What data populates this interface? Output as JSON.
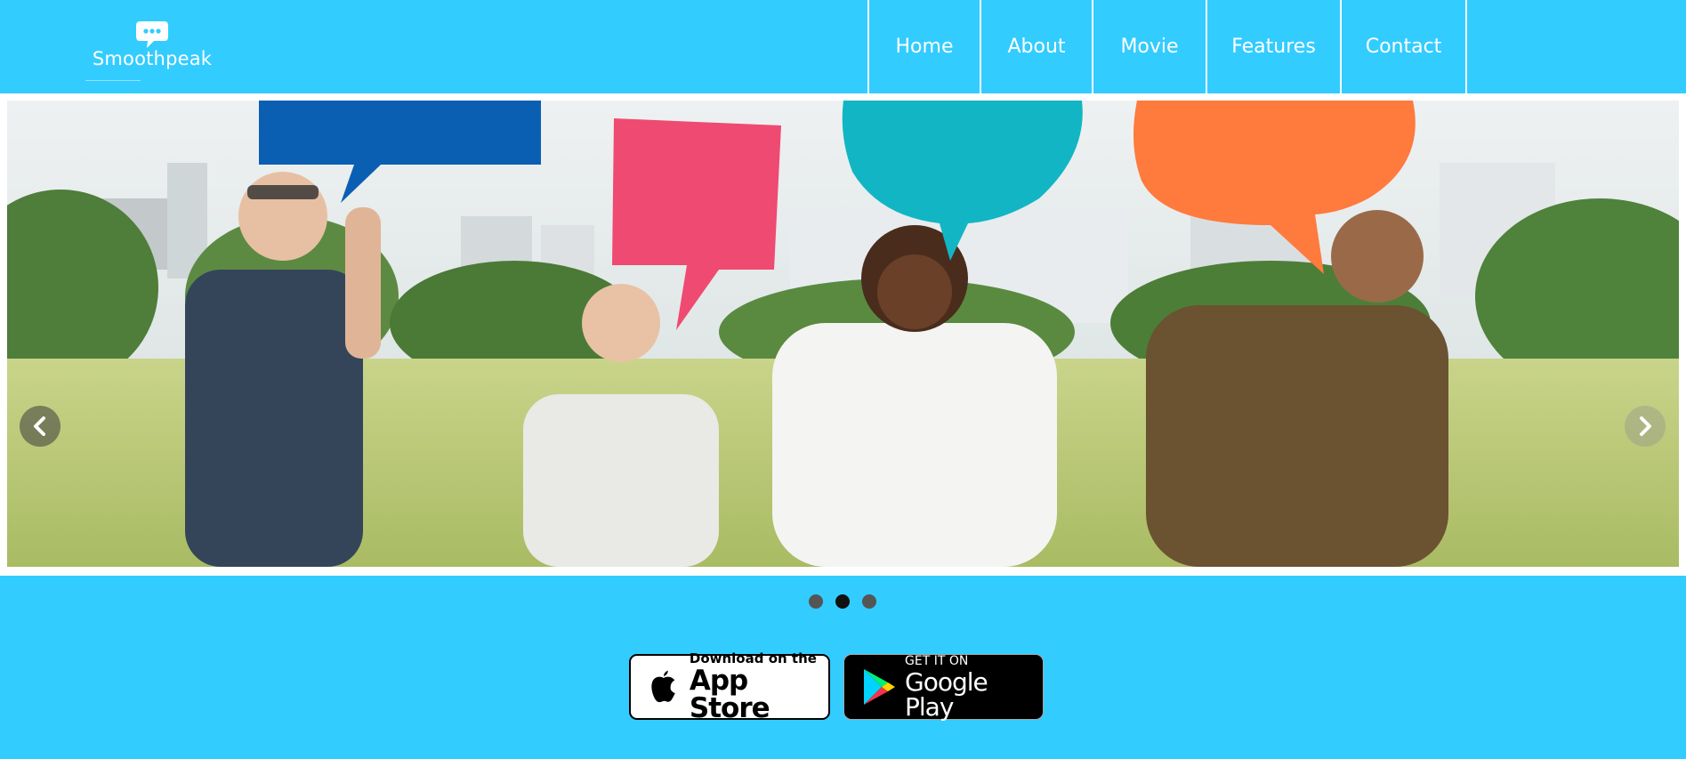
{
  "brand": {
    "name": "Smoothpeak",
    "icon": "chat-bubble-icon"
  },
  "nav": {
    "items": [
      {
        "label": "Home"
      },
      {
        "label": "About"
      },
      {
        "label": "Movie"
      },
      {
        "label": "Features"
      },
      {
        "label": "Contact"
      }
    ]
  },
  "slider": {
    "prev_icon": "chevron-left-icon",
    "next_icon": "chevron-right-icon",
    "slide_count": 3,
    "active_slide": 2
  },
  "stores": {
    "apple": {
      "line1": "Download on the",
      "line2": "App Store",
      "icon": "apple-icon"
    },
    "google": {
      "line1": "GET IT ON",
      "line2": "Google Play",
      "icon": "google-play-icon"
    }
  },
  "colors": {
    "background": "#33ccff",
    "bubble_blue": "#0b5fb3",
    "bubble_pink": "#ef4a72",
    "bubble_teal": "#12b5c4",
    "bubble_orange": "#ff7a3d"
  }
}
